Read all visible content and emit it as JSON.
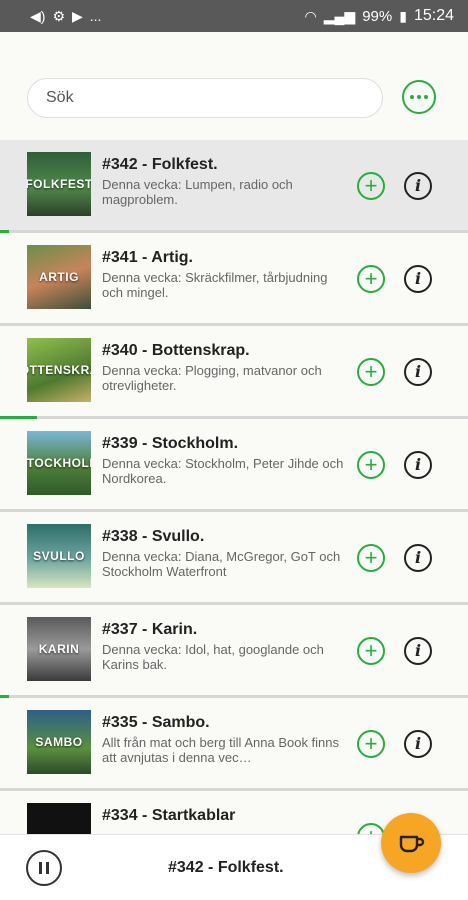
{
  "status_bar": {
    "battery": "99%",
    "time": "15:24",
    "notification_overflow": "...",
    "left_icons": [
      "volume-icon",
      "app-icon",
      "media-icon"
    ]
  },
  "search": {
    "placeholder": "Sök"
  },
  "colors": {
    "accent": "#27ae3c",
    "fab": "#f6a623",
    "active_row": "#e8e8e8"
  },
  "episodes": [
    {
      "title": "#342 - Folkfest.",
      "description": "Denna vecka: Lumpen, radio och magproblem.",
      "thumb_text": "FOLKFEST",
      "active": true,
      "progress": 0.02
    },
    {
      "title": "#341 - Artig.",
      "description": "Denna vecka: Skräckfilmer, tårbjudning och mingel.",
      "thumb_text": "ARTIG",
      "active": false,
      "progress": 0
    },
    {
      "title": "#340 - Bottenskrap.",
      "description": "Denna vecka: Plogging, matvanor och otrevligheter.",
      "thumb_text": "BOTTENSKRAP",
      "active": false,
      "progress": 0.08
    },
    {
      "title": "#339 - Stockholm.",
      "description": "Denna vecka: Stockholm, Peter Jihde och Nordkorea.",
      "thumb_text": "STOCKHOLM",
      "active": false,
      "progress": 0
    },
    {
      "title": "#338 - Svullo.",
      "description": "Denna vecka: Diana, McGregor, GoT och Stockholm Waterfront",
      "thumb_text": "SVULLO",
      "active": false,
      "progress": 0
    },
    {
      "title": "#337 - Karin.",
      "description": "Denna vecka: Idol, hat, googlande och Karins bak.",
      "thumb_text": "KARIN",
      "active": false,
      "progress": 0.02
    },
    {
      "title": "#335 - Sambo.",
      "description": "Allt från mat och berg till Anna Book finns att avnjutas i denna vec…",
      "thumb_text": "SAMBO",
      "active": false,
      "progress": 0
    },
    {
      "title": "#334 - Startkablar",
      "description": "",
      "thumb_text": "",
      "active": false,
      "progress": 0
    }
  ],
  "player": {
    "now_playing": "#342 - Folkfest."
  }
}
